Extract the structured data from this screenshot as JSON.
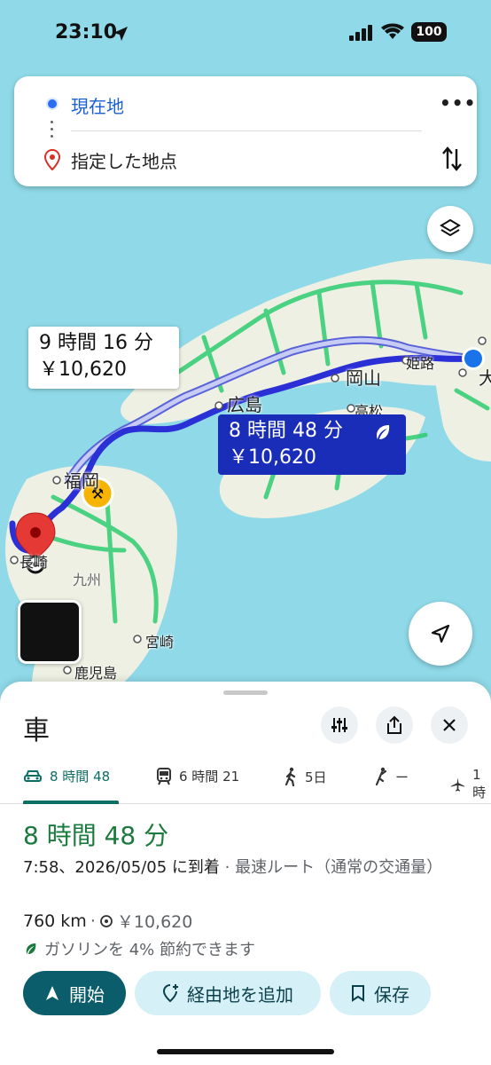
{
  "status_bar": {
    "time": "23:10",
    "battery": "100"
  },
  "search": {
    "origin": "現在地",
    "destination": "指定した地点"
  },
  "map": {
    "labels": {
      "hiroshima": "広島",
      "okayama": "岡山",
      "himeji": "姫路",
      "takamatsu": "高松",
      "fukuoka": "福岡",
      "nagasaki": "長崎",
      "kyushu": "九州",
      "miyazaki": "宮崎",
      "kagoshima": "鹿児島",
      "osaka_partial": "大"
    },
    "alt_route": {
      "time": "9 時間 16 分",
      "toll": "￥10,620"
    },
    "main_route": {
      "time": "8 時間 48 分",
      "toll": "￥10,620"
    },
    "colors": {
      "route_main": "#2b2fd6",
      "route_alt": "#a9b4f0",
      "land": "#f3f0e6",
      "water": "#8fd9e8",
      "roads": "#2ecc71"
    }
  },
  "sheet": {
    "mode_title": "車",
    "tabs": [
      {
        "icon": "car-icon",
        "label": "8 時間 48"
      },
      {
        "icon": "train-icon",
        "label": "6 時間 21"
      },
      {
        "icon": "walk-icon",
        "label": "5日"
      },
      {
        "icon": "ride-icon",
        "label": "ー"
      },
      {
        "icon": "plane-icon",
        "label": "1時"
      }
    ],
    "duration": "8 時間 48 分",
    "arrival": "7:58、2026/05/05 に到着",
    "arrival_note": "· 最速ルート（通常の交通量）",
    "distance": "760 km",
    "toll": "￥10,620",
    "eco_note": "ガソリンを 4% 節約できます",
    "buttons": {
      "start": "開始",
      "add_stop": "経由地を追加",
      "save": "保存"
    }
  }
}
